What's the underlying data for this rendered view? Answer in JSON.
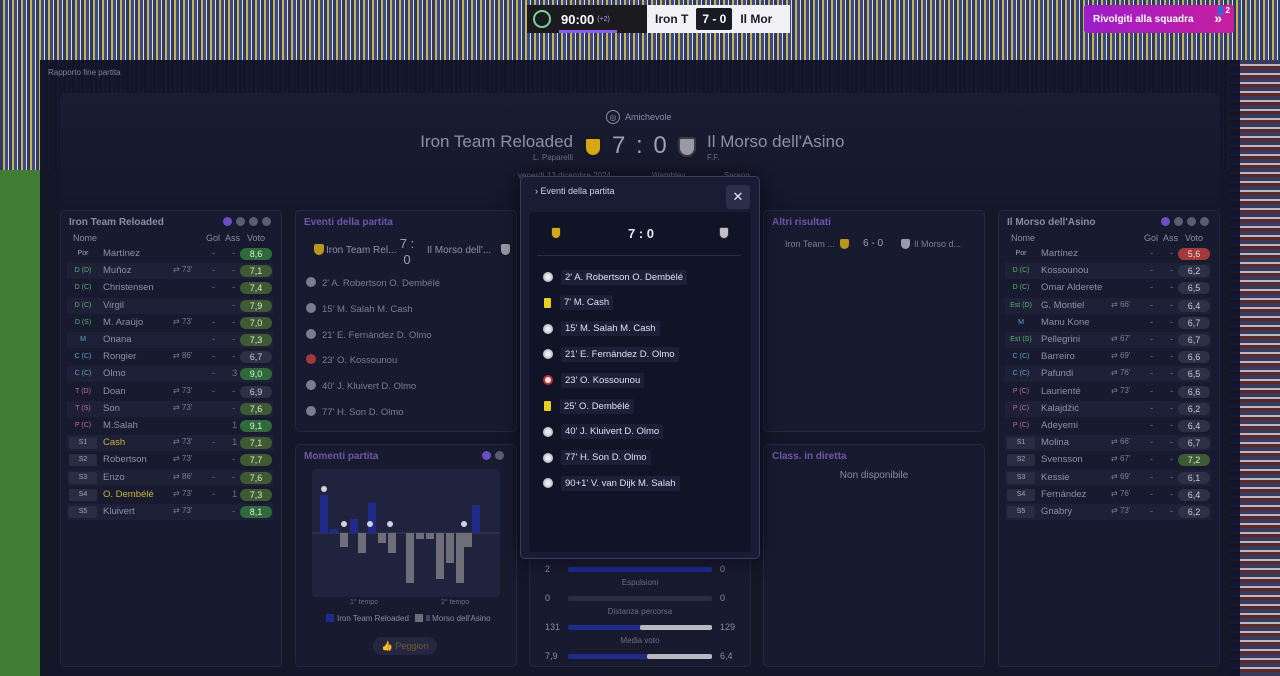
{
  "topbar": {
    "time": "90:00",
    "added_time": "(+2)",
    "home_short": "Iron T",
    "score": "7 - 0",
    "away_short": "Il Mor",
    "assistant_label": "Rivolgiti alla squadra",
    "assistant_count": "2"
  },
  "breadcrumb": "Rapporto fine partita",
  "match": {
    "competition": "Amichevole",
    "home": "Iron Team Reloaded",
    "away": "Il Morso dell'Asino",
    "home_manager": "L. Paparelli",
    "away_manager": "F.F.",
    "score": "7 : 0",
    "date": "venerdì 13 dicembre 2024",
    "venue": "Wembley",
    "weather": "Sereno"
  },
  "home_lineup": {
    "title": "Iron Team Reloaded",
    "headers": {
      "name": "Nome",
      "goals": "Gol",
      "assists": "Ass",
      "rating": "Voto"
    },
    "players": [
      {
        "pos": "Por",
        "name": "Martínez",
        "sub": "",
        "g": "-",
        "a": "-",
        "r": "8,6"
      },
      {
        "pos": "D (D)",
        "name": "Muñoz",
        "sub": "73'",
        "g": "-",
        "a": "-",
        "r": "7,1"
      },
      {
        "pos": "D (C)",
        "name": "Christensen",
        "sub": "",
        "g": "-",
        "a": "-",
        "r": "7,4"
      },
      {
        "pos": "D (C)",
        "name": "Virgil",
        "sub": "",
        "g": "",
        "a": "-",
        "r": "7,9"
      },
      {
        "pos": "D (S)",
        "name": "M. Araújo",
        "sub": "73'",
        "g": "-",
        "a": "-",
        "r": "7,0"
      },
      {
        "pos": "M",
        "name": "Onana",
        "sub": "",
        "g": "-",
        "a": "-",
        "r": "7,3"
      },
      {
        "pos": "C (C)",
        "name": "Rongier",
        "sub": "86'",
        "g": "-",
        "a": "-",
        "r": "6,7"
      },
      {
        "pos": "C (C)",
        "name": "Olmo",
        "sub": "",
        "g": "-",
        "a": "3",
        "r": "9,0"
      },
      {
        "pos": "T (D)",
        "name": "Doan",
        "sub": "73'",
        "g": "-",
        "a": "-",
        "r": "6,9"
      },
      {
        "pos": "T (S)",
        "name": "Son",
        "sub": "73'",
        "g": "",
        "a": "-",
        "r": "7,6"
      },
      {
        "pos": "P (C)",
        "name": "M.Salah",
        "sub": "",
        "g": "",
        "a": "1",
        "r": "9,1"
      },
      {
        "pos": "S1",
        "name": "Cash",
        "sub": "73'",
        "g": "-",
        "a": "1",
        "r": "7,1"
      },
      {
        "pos": "S2",
        "name": "Robertson",
        "sub": "73'",
        "g": "",
        "a": "-",
        "r": "7,7"
      },
      {
        "pos": "S3",
        "name": "Enzo",
        "sub": "86'",
        "g": "-",
        "a": "-",
        "r": "7,6"
      },
      {
        "pos": "S4",
        "name": "O. Dembélé",
        "sub": "73'",
        "g": "-",
        "a": "1",
        "r": "7,3"
      },
      {
        "pos": "S5",
        "name": "Kluivert",
        "sub": "73'",
        "g": "",
        "a": "-",
        "r": "8,1"
      }
    ]
  },
  "away_lineup": {
    "title": "Il Morso dell'Asino",
    "headers": {
      "name": "Nome",
      "goals": "Gol",
      "assists": "Ass",
      "rating": "Voto"
    },
    "players": [
      {
        "pos": "Por",
        "name": "Martínez",
        "sub": "",
        "g": "-",
        "a": "-",
        "r": "5,6"
      },
      {
        "pos": "D (C)",
        "name": "Kossounou",
        "sub": "",
        "g": "-",
        "a": "-",
        "r": "6,2"
      },
      {
        "pos": "D (C)",
        "name": "Omar Alderete",
        "sub": "",
        "g": "-",
        "a": "-",
        "r": "6,5"
      },
      {
        "pos": "Est (D)",
        "name": "G. Montiel",
        "sub": "66'",
        "g": "-",
        "a": "-",
        "r": "6,4"
      },
      {
        "pos": "M",
        "name": "Manu Kone",
        "sub": "",
        "g": "-",
        "a": "-",
        "r": "6,7"
      },
      {
        "pos": "Est (S)",
        "name": "Pellegrini",
        "sub": "67'",
        "g": "-",
        "a": "-",
        "r": "6,7"
      },
      {
        "pos": "C (C)",
        "name": "Barreiro",
        "sub": "69'",
        "g": "-",
        "a": "-",
        "r": "6,6"
      },
      {
        "pos": "C (C)",
        "name": "Pafundi",
        "sub": "76'",
        "g": "-",
        "a": "-",
        "r": "6,5"
      },
      {
        "pos": "P (C)",
        "name": "Laurienté",
        "sub": "73'",
        "g": "-",
        "a": "-",
        "r": "6,6"
      },
      {
        "pos": "P (C)",
        "name": "Kalajdžić",
        "sub": "",
        "g": "-",
        "a": "-",
        "r": "6,2"
      },
      {
        "pos": "P (C)",
        "name": "Adeyemi",
        "sub": "",
        "g": "-",
        "a": "-",
        "r": "6,4"
      },
      {
        "pos": "S1",
        "name": "Molina",
        "sub": "66'",
        "g": "-",
        "a": "-",
        "r": "6,7"
      },
      {
        "pos": "S2",
        "name": "Svensson",
        "sub": "67'",
        "g": "-",
        "a": "-",
        "r": "7,2"
      },
      {
        "pos": "S3",
        "name": "Kessie",
        "sub": "69'",
        "g": "-",
        "a": "-",
        "r": "6,1"
      },
      {
        "pos": "S4",
        "name": "Fernández",
        "sub": "76'",
        "g": "-",
        "a": "-",
        "r": "6,4"
      },
      {
        "pos": "S5",
        "name": "Gnabry",
        "sub": "73'",
        "g": "-",
        "a": "-",
        "r": "6,2"
      }
    ]
  },
  "events_panel": {
    "title": "Eventi della partita",
    "home": "Iron Team Rel...",
    "score": "7 : 0",
    "away": "Il Morso dell'...",
    "rows": [
      {
        "text": "2'  A. Robertson  O. Dembélé",
        "type": "goal"
      },
      {
        "text": "15'  M. Salah  M. Cash",
        "type": "goal"
      },
      {
        "text": "21'  E. Fernández  D. Olmo",
        "type": "goal"
      },
      {
        "text": "23'  O. Kossounou",
        "type": "own-goal"
      },
      {
        "text": "40'  J. Kluivert  D. Olmo",
        "type": "goal"
      },
      {
        "text": "77'  H. Son  D. Olmo",
        "type": "goal"
      }
    ]
  },
  "popup": {
    "title": "Eventi della partita",
    "score": "7 : 0",
    "events": [
      {
        "type": "goal",
        "text": "2'  A. Robertson  O. Dembélé"
      },
      {
        "type": "yellow",
        "text": "7'  M. Cash"
      },
      {
        "type": "goal",
        "text": "15'  M. Salah  M. Cash"
      },
      {
        "type": "goal",
        "text": "21'  E. Fernández  D. Olmo"
      },
      {
        "type": "own-goal",
        "text": "23'  O. Kossounou"
      },
      {
        "type": "yellow",
        "text": "25'  O. Dembélé"
      },
      {
        "type": "goal",
        "text": "40'  J. Kluivert  D. Olmo"
      },
      {
        "type": "goal",
        "text": "77'  H. Son  D. Olmo"
      },
      {
        "type": "goal",
        "text": "90+1'  V. van Dijk  M. Salah"
      }
    ]
  },
  "other_results": {
    "title": "Altri risultati",
    "home": "Iron Team ...",
    "score": "6 - 0",
    "away": "Il Morso d..."
  },
  "live_table": {
    "title": "Class. in diretta",
    "text": "Non disponibile"
  },
  "momentum": {
    "title": "Momenti partita",
    "first_half": "1° tempo",
    "second_half": "2° tempo",
    "legend_home": "Iron Team Reloaded",
    "legend_away": "Il Morso dell'Asino",
    "worst_button": "Peggiori",
    "home_color": "#1f2a8a",
    "away_color": "#6e6e78"
  },
  "stats": {
    "rows": [
      {
        "label": "",
        "home": "2",
        "away": "0",
        "home_frac": 1.0,
        "away_frac": 0.0
      },
      {
        "label": "Espulsioni",
        "home": "0",
        "away": "0",
        "home_frac": 0.0,
        "away_frac": 0.0
      },
      {
        "label": "Distanza percorsa",
        "home": "131",
        "away": "129",
        "home_frac": 0.5,
        "away_frac": 0.5
      },
      {
        "label": "Media voto",
        "home": "7,9",
        "away": "6,4",
        "home_frac": 0.55,
        "away_frac": 0.45
      }
    ]
  }
}
